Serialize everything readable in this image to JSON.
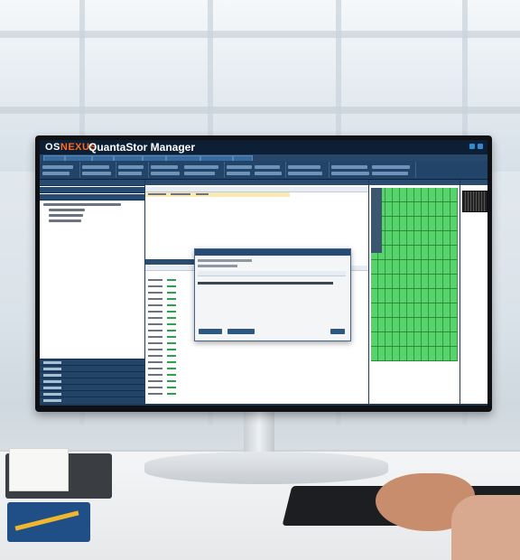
{
  "app": {
    "brand_prefix": "OS",
    "brand_mark": "NEXUS",
    "title": "QuantaStor Manager"
  },
  "scene": {
    "description_tags": [
      "monitor",
      "keyboard",
      "hand",
      "notebook",
      "pencil",
      "desk"
    ]
  },
  "colors": {
    "chrome": "#0d1f34",
    "ribbon": "#224468",
    "brand_accent": "#ff6a1f",
    "rack_green": "#58d36b",
    "selected_row": "#fbe9b5"
  }
}
